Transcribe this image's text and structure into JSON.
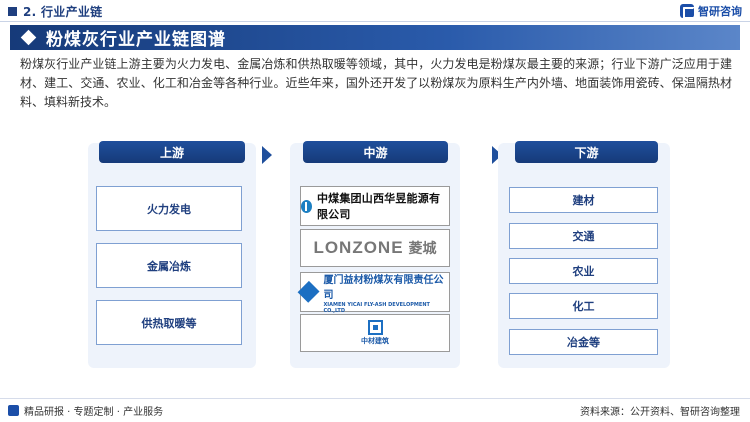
{
  "header": {
    "section_title": "2. 行业产业链",
    "brand": "智研咨询"
  },
  "title": "粉煤灰行业产业链图谱",
  "description": "粉煤灰行业产业链上游主要为火力发电、金属冶炼和供热取暖等领域，其中，火力发电是粉煤灰最主要的来源；行业下游广泛应用于建材、建工、交通、农业、化工和冶金等各种行业。近些年来，国外还开发了以粉煤灰为原料生产内外墙、地面装饰用瓷砖、保温隔热材料、填料新技术。",
  "upstream": {
    "label": "上游",
    "items": [
      "火力发电",
      "金属冶炼",
      "供热取暖等"
    ]
  },
  "midstream": {
    "label": "中游",
    "companies": [
      {
        "name": "中煤集团山西华昱能源有限公司",
        "icon": "zhongmei-logo-icon"
      },
      {
        "name": "LONZONE",
        "name_cn": "菱城",
        "icon": "lonzone-logo"
      },
      {
        "name": "厦门益材粉煤灰有限责任公司",
        "name_en": "XIAMEN YICAI FLY-ASH DEVELOPMENT CO.,LTD",
        "icon": "yicai-logo-icon"
      },
      {
        "name": "中材建筑",
        "icon": "zhongcai-logo-icon"
      }
    ]
  },
  "downstream": {
    "label": "下游",
    "items": [
      "建材",
      "交通",
      "农业",
      "化工",
      "冶金等"
    ]
  },
  "footer": {
    "left": "精品研报 · 专题定制 · 产业服务",
    "right": "资料来源：公开资料、智研咨询整理"
  },
  "colors": {
    "primary": "#1f3f7f",
    "accent": "#1f4f9c",
    "panel": "#eef3fb"
  }
}
